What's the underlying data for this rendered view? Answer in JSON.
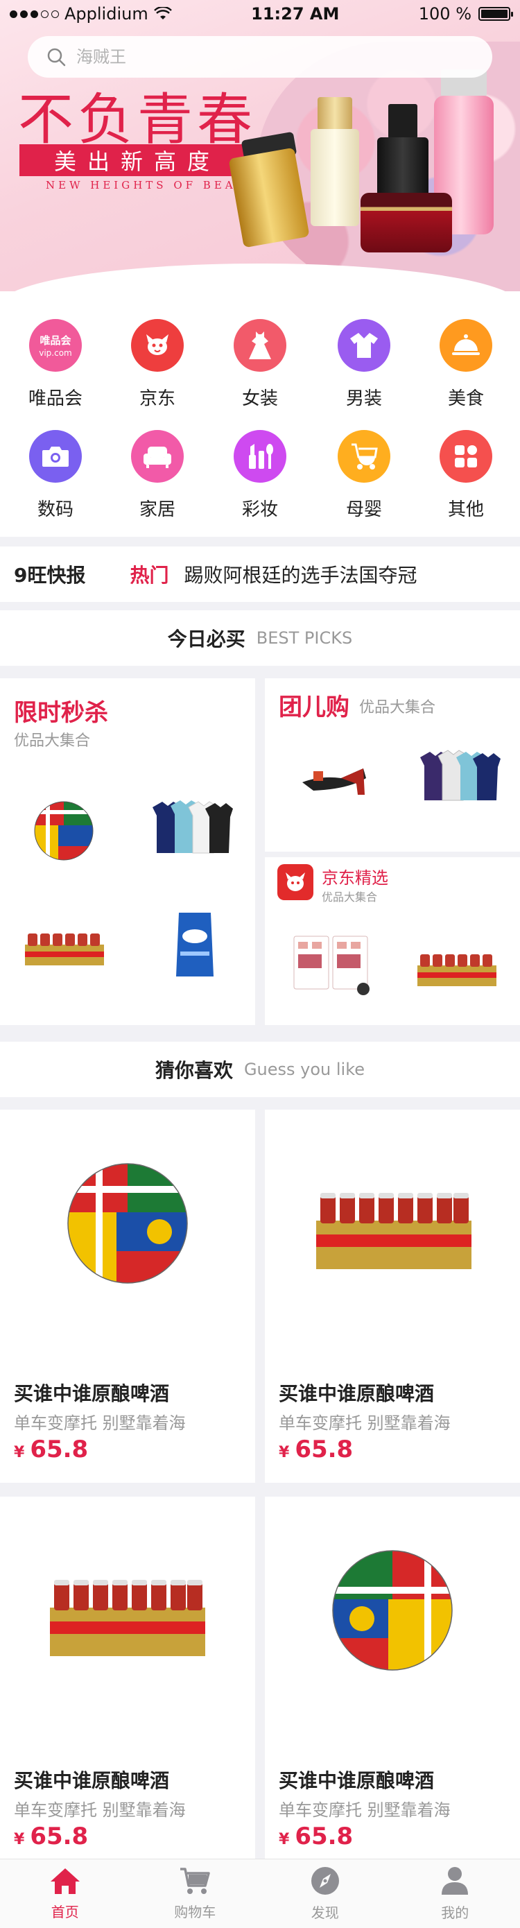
{
  "status_bar": {
    "carrier": "Applidium",
    "time": "11:27 AM",
    "battery": "100 %",
    "battery_level": 1.0
  },
  "search": {
    "placeholder": "海贼王"
  },
  "banner": {
    "title": "不负青春",
    "slogan": "美出新高度",
    "subtitle": "NEW HEIGHTS OF BEAUTY"
  },
  "categories": [
    {
      "label": "唯品会",
      "icon": "vipshop-logo-icon",
      "color": "#f15a9a",
      "badge_text": "唯品会 vip.com"
    },
    {
      "label": "京东",
      "icon": "jd-dog-icon",
      "color": "#ee3e3e"
    },
    {
      "label": "女装",
      "icon": "dress-icon",
      "color": "#f25a6a"
    },
    {
      "label": "男装",
      "icon": "shirt-icon",
      "color": "#9a5cf0"
    },
    {
      "label": "美食",
      "icon": "food-cloche-icon",
      "color": "#ff9a1f"
    },
    {
      "label": "数码",
      "icon": "camera-icon",
      "color": "#7a60f0"
    },
    {
      "label": "家居",
      "icon": "sofa-icon",
      "color": "#f25aa8"
    },
    {
      "label": "彩妆",
      "icon": "makeup-icon",
      "color": "#ce4af0"
    },
    {
      "label": "母婴",
      "icon": "stroller-icon",
      "color": "#ffae1f"
    },
    {
      "label": "其他",
      "icon": "grid-icon",
      "color": "#f5504e"
    }
  ],
  "news": {
    "brand": "9旺快报",
    "tag": "热门",
    "text": "踢败阿根廷的选手法国夺冠"
  },
  "picks_header": {
    "cn": "今日必买",
    "en": "BEST PICKS"
  },
  "deals": {
    "flash": {
      "title": "限时秒杀",
      "sub": "优品大集合"
    },
    "group": {
      "title": "团儿购",
      "sub": "优品大集合"
    },
    "jd": {
      "title": "京东精选",
      "sub": "优品大集合"
    }
  },
  "guess_header": {
    "cn": "猜你喜欢",
    "en": "Guess you like"
  },
  "products": [
    {
      "name": "买谁中谁原酿啤酒",
      "desc": "单车变摩托 别墅靠着海",
      "currency": "¥",
      "price": "65.8",
      "image": "soccer-ball"
    },
    {
      "name": "买谁中谁原酿啤酒",
      "desc": "单车变摩托 别墅靠着海",
      "currency": "¥",
      "price": "65.8",
      "image": "beer-case"
    },
    {
      "name": "买谁中谁原酿啤酒",
      "desc": "单车变摩托 别墅靠着海",
      "currency": "¥",
      "price": "65.8",
      "image": "beer-case"
    },
    {
      "name": "买谁中谁原酿啤酒",
      "desc": "单车变摩托 别墅靠着海",
      "currency": "¥",
      "price": "65.8",
      "image": "soccer-ball"
    }
  ],
  "tabbar": [
    {
      "label": "首页",
      "icon": "home-icon",
      "active": true
    },
    {
      "label": "购物车",
      "icon": "cart-icon",
      "active": false
    },
    {
      "label": "发现",
      "icon": "compass-icon",
      "active": false
    },
    {
      "label": "我的",
      "icon": "person-icon",
      "active": false
    }
  ],
  "colors": {
    "accent": "#e0224a",
    "background": "#f1f1f5",
    "muted": "#999999"
  }
}
